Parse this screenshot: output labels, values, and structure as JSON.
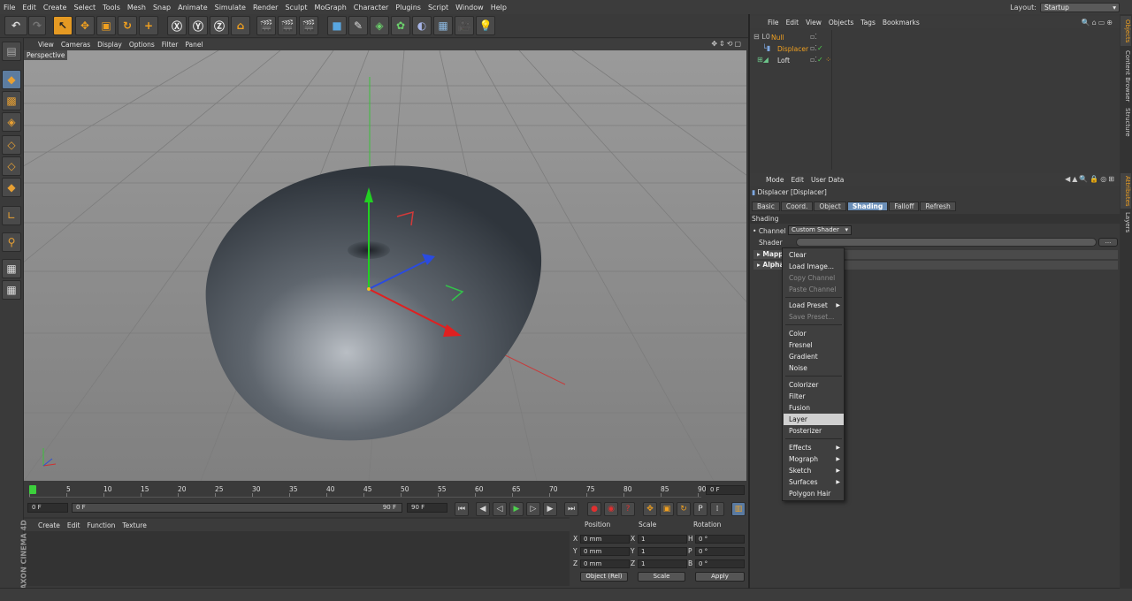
{
  "menubar": {
    "items": [
      "File",
      "Edit",
      "Create",
      "Select",
      "Tools",
      "Mesh",
      "Snap",
      "Animate",
      "Simulate",
      "Render",
      "Sculpt",
      "MoGraph",
      "Character",
      "Plugins",
      "Script",
      "Window",
      "Help"
    ],
    "layout_label": "Layout:",
    "layout_value": "Startup"
  },
  "viewport": {
    "menu": [
      "View",
      "Cameras",
      "Display",
      "Options",
      "Filter",
      "Panel"
    ],
    "label": "Perspective"
  },
  "timeline": {
    "ticks": [
      "0",
      "5",
      "10",
      "15",
      "20",
      "25",
      "30",
      "35",
      "40",
      "45",
      "50",
      "55",
      "60",
      "65",
      "70",
      "75",
      "80",
      "85",
      "90"
    ],
    "current_frame": "0 F",
    "start_field": "0 F",
    "range_start": "0 F",
    "range_end": "90 F",
    "end_field": "90 F"
  },
  "material_manager": {
    "menu": [
      "Create",
      "Edit",
      "Function",
      "Texture"
    ]
  },
  "coordinates": {
    "headers": [
      "Position",
      "Scale",
      "Rotation"
    ],
    "rows": [
      {
        "axis": "X",
        "pos": "0 mm",
        "saxis": "X",
        "scale": "1",
        "raxis": "H",
        "rot": "0 °"
      },
      {
        "axis": "Y",
        "pos": "0 mm",
        "saxis": "Y",
        "scale": "1",
        "raxis": "P",
        "rot": "0 °"
      },
      {
        "axis": "Z",
        "pos": "0 mm",
        "saxis": "Z",
        "scale": "1",
        "raxis": "B",
        "rot": "0 °"
      }
    ],
    "mode_select": "Object (Rel)",
    "scale_select": "Scale",
    "apply_label": "Apply"
  },
  "object_manager": {
    "menu": [
      "File",
      "Edit",
      "View",
      "Objects",
      "Tags",
      "Bookmarks"
    ],
    "objects": [
      {
        "name": "Null",
        "color": "#f0a020"
      },
      {
        "name": "Displacer",
        "color": "#f0a020"
      },
      {
        "name": "Loft",
        "color": "#e0e0e0"
      }
    ]
  },
  "attributes": {
    "menu": [
      "Mode",
      "Edit",
      "User Data"
    ],
    "title": "Displacer [Displacer]",
    "tabs": [
      "Basic",
      "Coord.",
      "Object",
      "Shading",
      "Falloff",
      "Refresh"
    ],
    "active_tab": "Shading",
    "section": "Shading",
    "channel_label": "Channel",
    "channel_value": "Custom Shader",
    "shader_label": "Shader",
    "shader_button": "...",
    "groups": [
      "Mappi",
      "Alpha"
    ]
  },
  "context_menu": {
    "items": [
      {
        "label": "Clear",
        "disabled": false
      },
      {
        "label": "Load Image...",
        "disabled": false
      },
      {
        "label": "Copy Channel",
        "disabled": true
      },
      {
        "label": "Paste Channel",
        "disabled": true
      },
      {
        "label": "Load Preset",
        "disabled": false
      },
      {
        "label": "Save Preset...",
        "disabled": true
      },
      {
        "label": "Color",
        "disabled": false
      },
      {
        "label": "Fresnel",
        "disabled": false
      },
      {
        "label": "Gradient",
        "disabled": false
      },
      {
        "label": "Noise",
        "disabled": false
      },
      {
        "label": "Colorizer",
        "disabled": false
      },
      {
        "label": "Filter",
        "disabled": false
      },
      {
        "label": "Fusion",
        "disabled": false
      },
      {
        "label": "Layer",
        "disabled": false
      },
      {
        "label": "Posterizer",
        "disabled": false
      },
      {
        "label": "Effects",
        "disabled": false
      },
      {
        "label": "Mograph",
        "disabled": false
      },
      {
        "label": "Sketch",
        "disabled": false
      },
      {
        "label": "Surfaces",
        "disabled": false
      },
      {
        "label": "Polygon Hair",
        "disabled": false
      }
    ],
    "highlighted": "Layer"
  },
  "side_tabs": [
    "Objects",
    "Content Browser",
    "Structure",
    "Attributes",
    "Layers"
  ],
  "branding": "MAXON CINEMA 4D",
  "colors": {
    "accent": "#f0a020",
    "highlight": "#6b8fb8"
  }
}
